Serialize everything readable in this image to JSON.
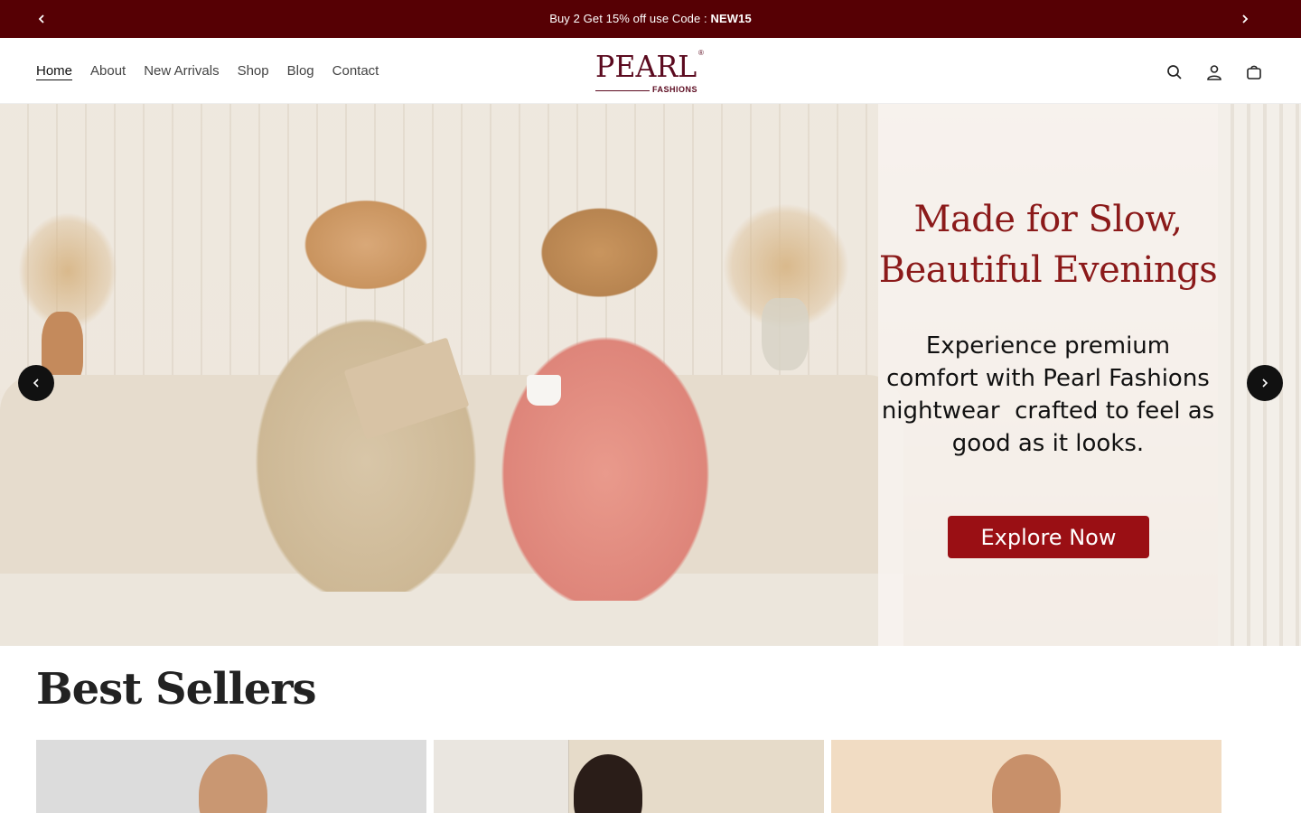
{
  "announcement": {
    "text_prefix": "Buy 2 Get 15% off use Code : ",
    "code": "NEW15"
  },
  "header": {
    "nav": [
      {
        "label": "Home",
        "active": true
      },
      {
        "label": "About"
      },
      {
        "label": "New Arrivals"
      },
      {
        "label": "Shop"
      },
      {
        "label": "Blog"
      },
      {
        "label": "Contact"
      }
    ],
    "logo": {
      "word": "PEARL",
      "sub": "FASHIONS",
      "mark": "®"
    },
    "icons": [
      "search-icon",
      "account-icon",
      "cart-icon"
    ]
  },
  "hero": {
    "title_line1": "Made for Slow,",
    "title_line2": "Beautiful Evenings",
    "body": "Experience premium comfort with Pearl Fashions nightwear  crafted to feel as good as it looks.",
    "cta": "Explore Now"
  },
  "best_sellers": {
    "title": "Best Sellers",
    "products": [
      {
        "bg": "#dcdcdc"
      },
      {
        "bg": "#ebe4d8"
      },
      {
        "bg": "#f1dcc3"
      }
    ]
  },
  "colors": {
    "announcement_bg": "#560004",
    "brand": "#5b0a1f",
    "hero_title": "#8b1a1a",
    "cta_bg": "#9a0f14"
  }
}
